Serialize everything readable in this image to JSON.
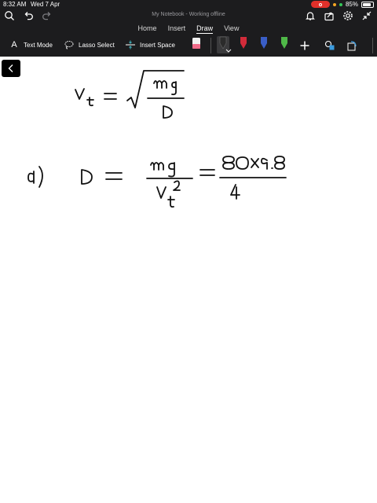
{
  "status_bar": {
    "time": "8:32 AM",
    "date": "Wed 7 Apr",
    "battery": "85%",
    "battery_level": 0.85
  },
  "title_bar": {
    "doc_title": "My Notebook - Working offline"
  },
  "tabs": [
    {
      "label": "Home"
    },
    {
      "label": "Insert"
    },
    {
      "label": "Draw"
    },
    {
      "label": "View"
    }
  ],
  "active_tab": "Draw",
  "toolbar": {
    "text_mode": "Text Mode",
    "lasso_select": "Lasso Select",
    "insert_space": "Insert Space"
  },
  "pen_colors": {
    "pen1": "#2b2b2b",
    "pen2": "#d22b3a",
    "pen3": "#3a5ec7",
    "pen4": "#4fb848"
  },
  "colors": {
    "chrome": "#1c1c1e",
    "accent": "#e0302a"
  }
}
